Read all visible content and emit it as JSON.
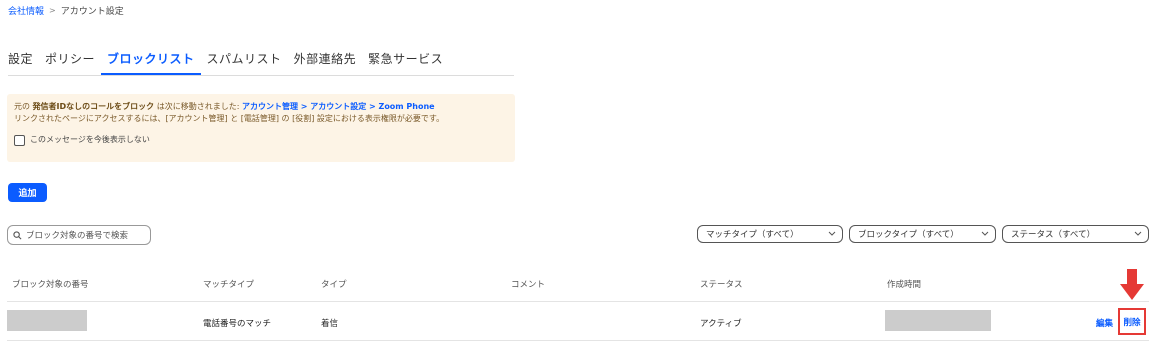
{
  "breadcrumb": {
    "parent": "会社情報",
    "separator": ">",
    "current": "アカウント設定"
  },
  "tabs": [
    {
      "label": "設定"
    },
    {
      "label": "ポリシー"
    },
    {
      "label": "ブロックリスト"
    },
    {
      "label": "スパムリスト"
    },
    {
      "label": "外部連絡先"
    },
    {
      "label": "緊急サービス"
    }
  ],
  "active_tab": "ブロックリスト",
  "notice": {
    "line1_pre": "元の",
    "line1_bold": "発信者IDなしのコールをブロック",
    "line1_mid": "は次に移動されました:",
    "line1_link": "アカウント管理 > アカウント設定 > Zoom Phone",
    "line2": "リンクされたページにアクセスするには、[アカウント管理] と [電話管理] の [役割] 設定における表示権限が必要です。",
    "checkbox_label": "このメッセージを今後表示しない"
  },
  "add_button": "追加",
  "search": {
    "placeholder": "ブロック対象の番号で検索"
  },
  "filters": {
    "match_type": "マッチタイプ（すべて）",
    "block_type": "ブロックタイプ（すべて）",
    "status": "ステータス（すべて）"
  },
  "table": {
    "columns": [
      "ブロック対象の番号",
      "マッチタイプ",
      "タイプ",
      "コメント",
      "ステータス",
      "作成時間"
    ],
    "rows": [
      {
        "number": "",
        "match_type": "電話番号のマッチ",
        "type": "着信",
        "comment": "",
        "status": "アクティブ",
        "created": "",
        "edit": "編集",
        "delete": "削除"
      }
    ]
  },
  "colors": {
    "accent": "#0b5cff",
    "highlight": "#e53935",
    "notice_bg": "#fdf4e6"
  }
}
